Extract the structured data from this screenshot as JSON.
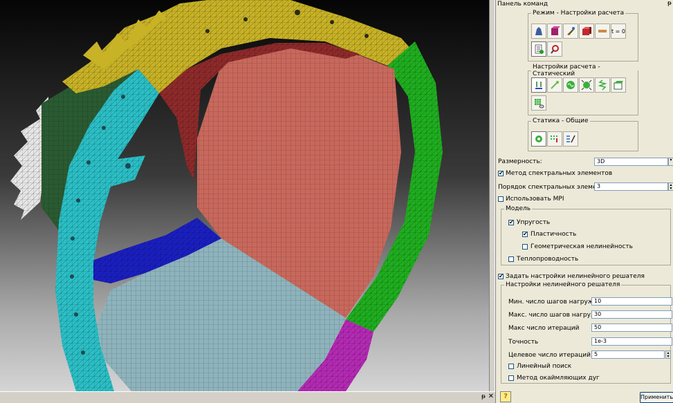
{
  "panel": {
    "title": "Панель команд",
    "pin": "ᵽ",
    "groups": {
      "mode": "Режим - Настройки расчета",
      "calc": "Настройки расчета - Статический",
      "static": "Статика - Общие"
    },
    "mode_time_icon": "t = 0",
    "fields": {
      "dimension_label": "Размерность:",
      "dimension_value": "3D",
      "spectral_label": "Метод спектральных элементов",
      "spectral_order_label": "Порядок спектральных элементов",
      "spectral_order_value": "3",
      "mpi_label": "Использовать MPI"
    },
    "model": {
      "title": "Модель",
      "elasticity": "Упругость",
      "plasticity": "Пластичность",
      "geom_nonlinear": "Геометрическая нелинейность",
      "heat": "Теплопроводность"
    },
    "nonlinear": {
      "enable_label": "Задать настройки нелинейного решателя",
      "group_title": "Настройки нелинейного решателя",
      "min_steps_label": "Мин. число шагов нагружения",
      "min_steps_value": "10",
      "max_steps_label": "Макс. число шагов нагружения",
      "max_steps_value": "30",
      "max_iter_label": "Макс число итераций",
      "max_iter_value": "50",
      "accuracy_label": "Точность",
      "accuracy_value": "1e-3",
      "target_iter_label": "Целевое число итераций",
      "target_iter_value": "5",
      "line_search_label": "Линейный поиск",
      "arc_length_label": "Метод окаймляющих дуг"
    },
    "checks": {
      "check": "✔",
      "empty": ""
    },
    "apply_label": "Применить",
    "help_icon": "?"
  },
  "viewport": {
    "dock_label": "ᵽ",
    "close_label": "✕",
    "colors": {
      "yellow": "#c8b226",
      "cyan": "#2bbfc6",
      "green": "#1fae1f",
      "salmon": "#c8685c",
      "lightblue": "#8eb3bc",
      "blue": "#1a1fc0",
      "magenta": "#b42ab4",
      "white": "#e6e6e6",
      "darkgreen": "#2a5a32",
      "brown": "#6b3a2a",
      "red": "#8e2a2a"
    }
  }
}
